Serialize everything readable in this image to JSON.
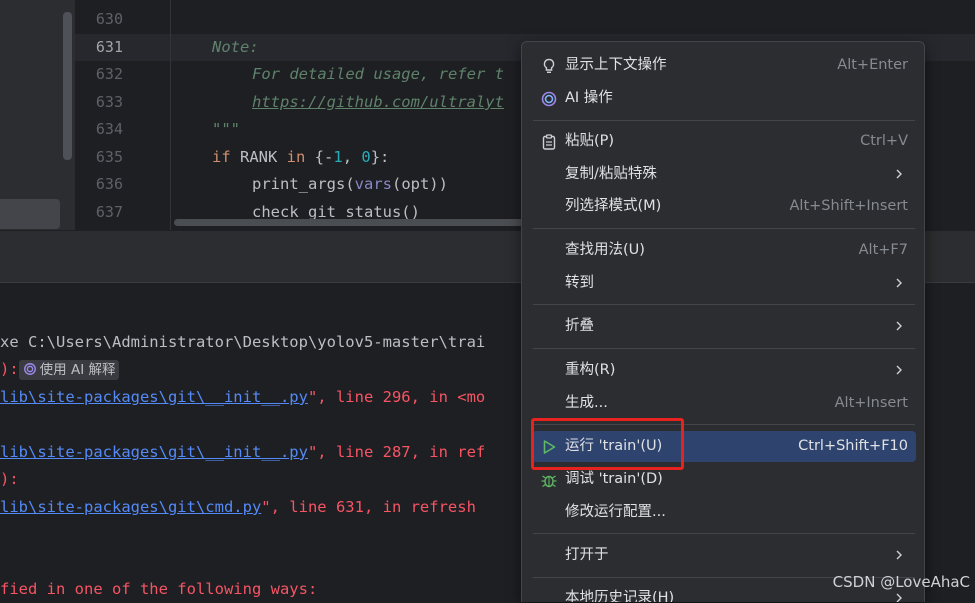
{
  "editor": {
    "line_numbers": [
      "630",
      "631",
      "632",
      "633",
      "634",
      "635",
      "636",
      "637"
    ],
    "current_line": "631",
    "code": {
      "l631": "Note:",
      "l632": "For detailed usage, refer t",
      "l633": "https://github.com/ultralyt",
      "l634": "\"\"\"",
      "l635_kw1": "if",
      "l635_var": " RANK ",
      "l635_kw2": "in",
      "l635_open": " {-",
      "l635_n1": "1",
      "l635_mid": ", ",
      "l635_n2": "0",
      "l635_close": "}:",
      "l636_fn": "print_args(",
      "l636_bi": "vars",
      "l636_rest": "(opt))",
      "l637": "check_git_status()"
    }
  },
  "console": {
    "line1": "xe C:\\Users\\Administrator\\Desktop\\yolov5-master\\trai",
    "line2_prefix": "):",
    "ai_explain": "使用 AI 解释",
    "line3_link": "lib\\site-packages\\git\\__init__.py",
    "line3_rest": "\", line 296, in <mo",
    "line4_link": "lib\\site-packages\\git\\__init__.py",
    "line4_rest": "\", line 287, in ref",
    "line5": "):",
    "line6_link": "lib\\site-packages\\git\\cmd.py",
    "line6_rest": "\", line 631, in refresh",
    "line7": "fied in one of the following ways:"
  },
  "menu": {
    "items": [
      {
        "label": "显示上下文操作",
        "shortcut": "Alt+Enter"
      },
      {
        "label": "AI 操作",
        "shortcut": ""
      },
      {
        "label": "粘贴(P)",
        "shortcut": "Ctrl+V"
      },
      {
        "label": "复制/粘贴特殊",
        "shortcut": ""
      },
      {
        "label": "列选择模式(M)",
        "shortcut": "Alt+Shift+Insert"
      },
      {
        "label": "查找用法(U)",
        "shortcut": "Alt+F7"
      },
      {
        "label": "转到",
        "shortcut": ""
      },
      {
        "label": "折叠",
        "shortcut": ""
      },
      {
        "label": "重构(R)",
        "shortcut": ""
      },
      {
        "label": "生成...",
        "shortcut": "Alt+Insert"
      },
      {
        "label": "运行 'train'(U)",
        "shortcut": "Ctrl+Shift+F10"
      },
      {
        "label": "调试 'train'(D)",
        "shortcut": ""
      },
      {
        "label": "修改运行配置...",
        "shortcut": ""
      },
      {
        "label": "打开于",
        "shortcut": ""
      },
      {
        "label": "本地历史记录(H)",
        "shortcut": ""
      }
    ]
  },
  "watermark": "CSDN @LoveAhaC",
  "colors": {
    "menu_bg": "#2b2d30",
    "menu_active": "#2e436e",
    "run_icon": "#5fb865",
    "debug_icon": "#5fb865",
    "error_text": "#f75464",
    "link": "#548af7",
    "annotation_box": "#e8231f"
  },
  "icons": {
    "context_actions": "lightbulb-icon",
    "ai_actions": "ai-spiral-icon",
    "paste": "clipboard-icon",
    "run": "run-triangle-icon",
    "debug": "bug-icon",
    "submenu": "chevron-right-icon"
  }
}
